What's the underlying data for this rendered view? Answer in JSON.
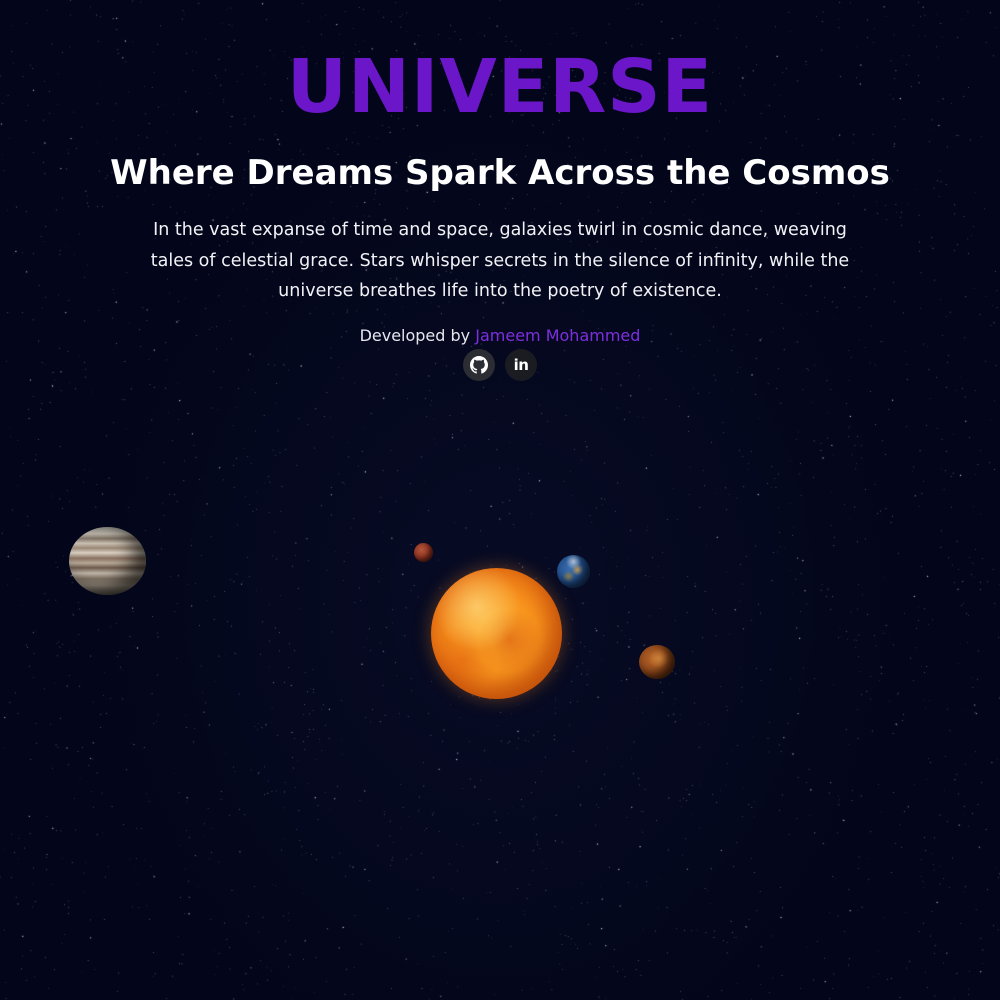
{
  "header": {
    "brand": "UNIVERSE",
    "tagline": "Where Dreams Spark Across the Cosmos",
    "description": "In the vast expanse of time and space, galaxies twirl in cosmic dance, weaving tales of celestial grace. Stars whisper secrets in the silence of infinity, while the universe breathes life into the poetry of existence."
  },
  "credit": {
    "prefix": "Developed by",
    "author": "Jameem Mohammed"
  },
  "socials": [
    {
      "name": "github",
      "icon": "github-icon"
    },
    {
      "name": "linkedin",
      "icon": "linkedin-icon",
      "glyph": "in"
    }
  ],
  "colors": {
    "background": "#03061a",
    "brand": "#6b16c9",
    "link": "#7d2fe0",
    "text": "#ffffff"
  },
  "scene": {
    "bodies": [
      "sun",
      "jupiter",
      "mars",
      "earth",
      "venus"
    ]
  }
}
